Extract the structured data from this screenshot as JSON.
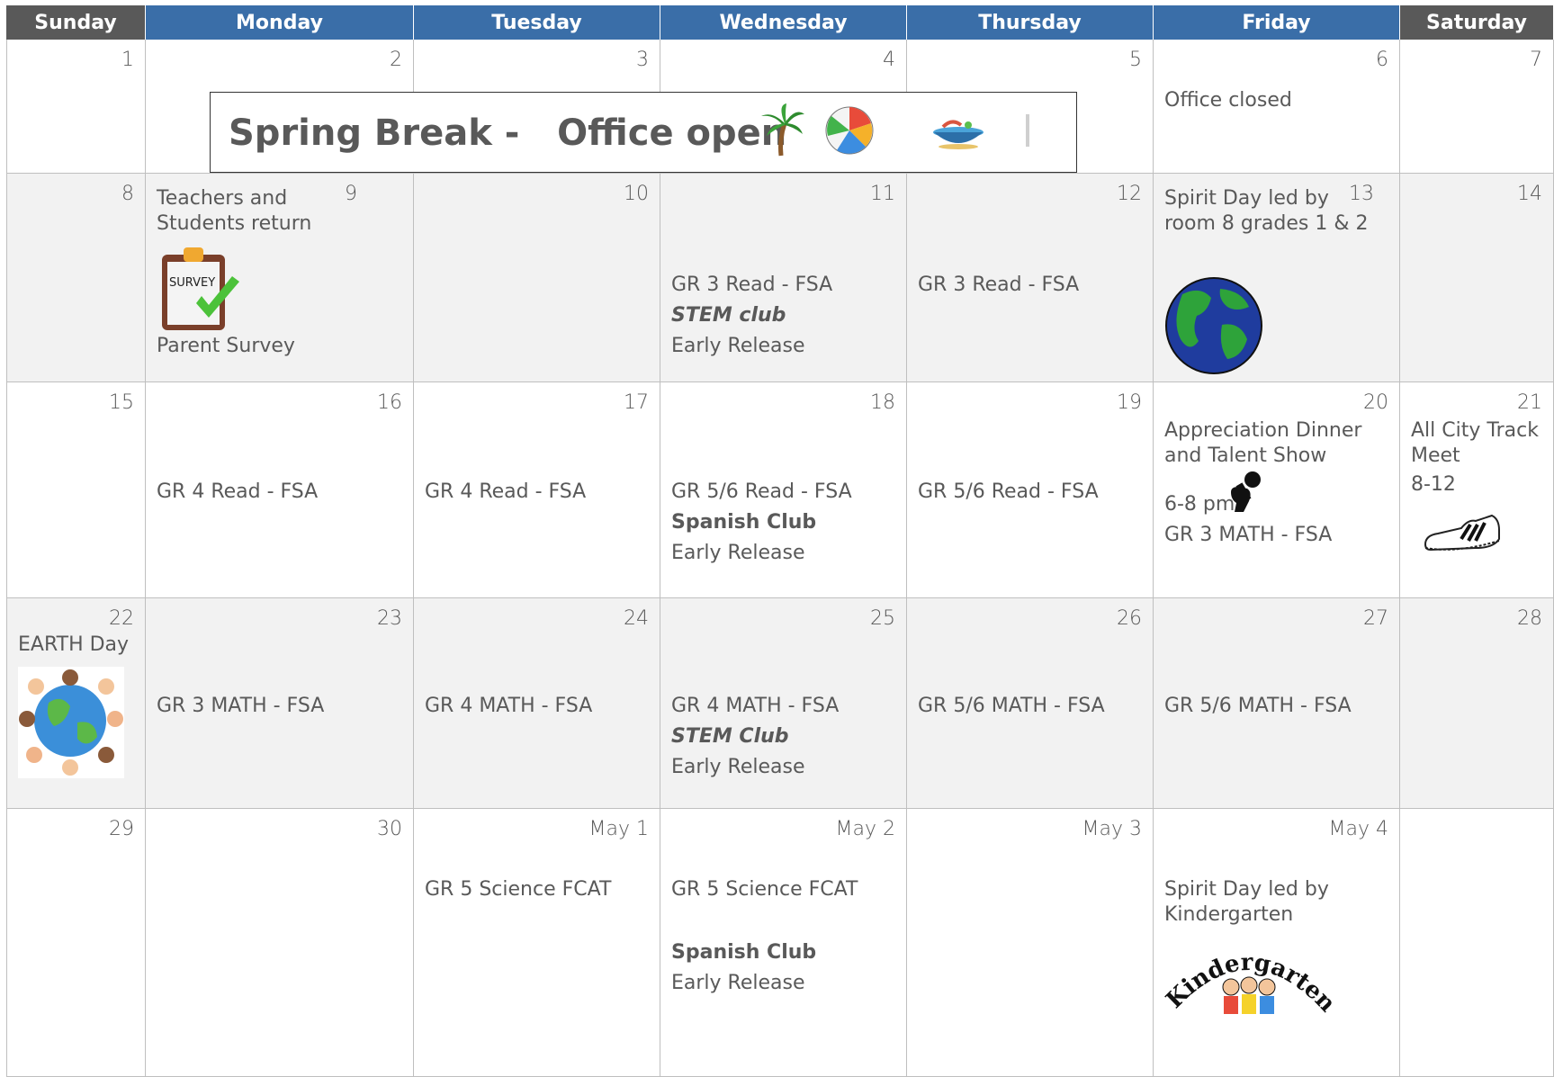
{
  "colors": {
    "header_bg": "#3a6ea8",
    "header_bg_weekend": "#595959",
    "shade": "#f2f2f2",
    "text": "#595959"
  },
  "days": [
    "Sunday",
    "Monday",
    "Tuesday",
    "Wednesday",
    "Thursday",
    "Friday",
    "Saturday"
  ],
  "banner": {
    "text": "Spring Break -   Office open"
  },
  "weeks": [
    {
      "dates": [
        "1",
        "2",
        "3",
        "4",
        "5",
        "6",
        "7"
      ]
    },
    {
      "dates": [
        "8",
        "9",
        "10",
        "11",
        "12",
        "13",
        "14"
      ]
    },
    {
      "dates": [
        "15",
        "16",
        "17",
        "18",
        "19",
        "20",
        "21"
      ]
    },
    {
      "dates": [
        "22",
        "23",
        "24",
        "25",
        "26",
        "27",
        "28"
      ]
    },
    {
      "dates": [
        "29",
        "30",
        "May 1",
        "May 2",
        "May 3",
        "May 4",
        ""
      ]
    }
  ],
  "events": {
    "w0_fri": "Office closed",
    "w1_mon_1": "Teachers and",
    "w1_mon_2": "Students return",
    "w1_mon_survey": "SURVEY",
    "w1_mon_3": "Parent Survey",
    "w1_wed_1": "GR 3 Read - FSA",
    "w1_wed_2": "STEM club",
    "w1_wed_3": "Early Release",
    "w1_thu_1": "GR 3 Read - FSA",
    "w1_fri_1": "Spirit Day led by",
    "w1_fri_2": "room 8 grades 1 & 2",
    "w2_mon": "GR 4 Read - FSA",
    "w2_tue": "GR 4 Read - FSA",
    "w2_wed_1": "GR 5/6 Read - FSA",
    "w2_wed_2": "Spanish Club",
    "w2_wed_3": "Early Release",
    "w2_thu": "GR 5/6 Read - FSA",
    "w2_fri_1": "Appreciation Dinner",
    "w2_fri_2": "and Talent Show",
    "w2_fri_3": "6-8 pm",
    "w2_fri_4": "GR 3 MATH - FSA",
    "w2_sat_1": "All City Track",
    "w2_sat_2": "Meet",
    "w2_sat_3": "8-12",
    "w3_sun": "EARTH Day",
    "w3_mon": "GR 3 MATH - FSA",
    "w3_tue": "GR 4 MATH - FSA",
    "w3_wed_1": "GR 4 MATH - FSA",
    "w3_wed_2": "STEM Club",
    "w3_wed_3": "Early Release",
    "w3_thu": "GR 5/6 MATH - FSA",
    "w3_fri": "GR 5/6 MATH - FSA",
    "w4_tue": "GR 5 Science FCAT",
    "w4_wed_1": "GR 5 Science FCAT",
    "w4_wed_2": "Spanish Club",
    "w4_wed_3": "Early Release",
    "w4_fri_1": "Spirit Day led by",
    "w4_fri_2": "Kindergarten",
    "w4_fri_art": "Kindergarten"
  },
  "icons": [
    "palm-tree-icon",
    "beach-ball-icon",
    "bowl-icon",
    "survey-clipboard-icon",
    "earth-globe-icon",
    "microphone-fist-icon",
    "sneaker-icon",
    "earth-children-icon",
    "kindergarten-kids-icon"
  ]
}
